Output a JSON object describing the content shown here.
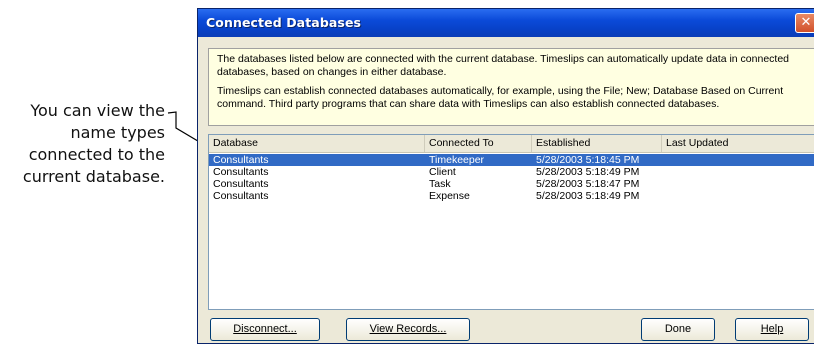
{
  "callout": {
    "lines": [
      "You can view the",
      "name types",
      "connected to the",
      "current database."
    ]
  },
  "window": {
    "title": "Connected Databases",
    "close_glyph": "✕"
  },
  "info": {
    "para1": "The databases listed below are connected with the current database. Timeslips can automatically update data in connected databases, based on changes in either database.",
    "para2": "Timeslips can establish connected databases automatically, for example, using the File; New; Database Based on Current command. Third party programs that can share data with Timeslips can also establish connected databases."
  },
  "table": {
    "columns": [
      "Database",
      "Connected To",
      "Established",
      "Last Updated"
    ],
    "rows": [
      {
        "database": "Consultants",
        "connected_to": "Timekeeper",
        "established": "5/28/2003 5:18:45 PM",
        "last_updated": "",
        "selected": true
      },
      {
        "database": "Consultants",
        "connected_to": "Client",
        "established": "5/28/2003 5:18:49 PM",
        "last_updated": "",
        "selected": false
      },
      {
        "database": "Consultants",
        "connected_to": "Task",
        "established": "5/28/2003 5:18:47 PM",
        "last_updated": "",
        "selected": false
      },
      {
        "database": "Consultants",
        "connected_to": "Expense",
        "established": "5/28/2003 5:18:49 PM",
        "last_updated": "",
        "selected": false
      }
    ]
  },
  "buttons": {
    "disconnect": "Disconnect...",
    "view_records": "View Records...",
    "done": "Done",
    "help": "Help"
  },
  "colors": {
    "titlebar": "#0842c9",
    "selection": "#316ac5",
    "info_bg": "#ffffe1"
  }
}
